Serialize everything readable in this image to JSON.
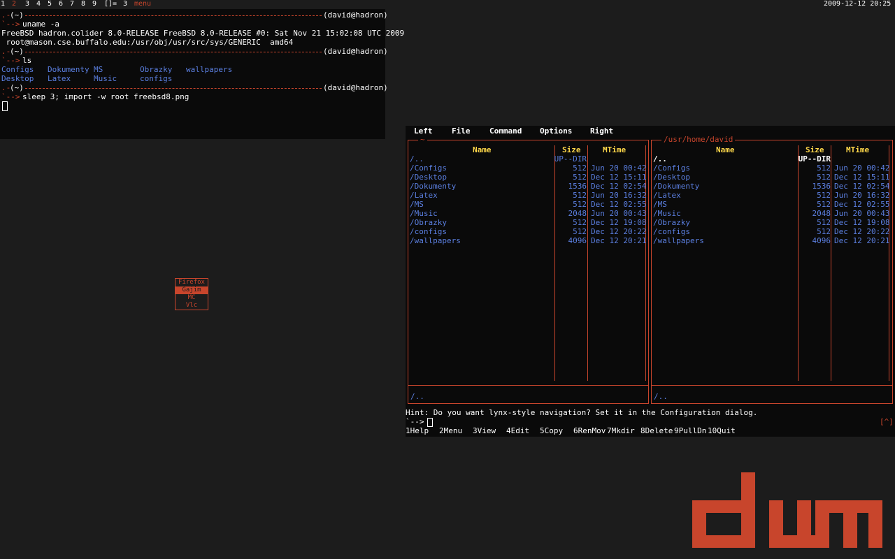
{
  "statusbar": {
    "tags": [
      "1",
      "2",
      "3",
      "4",
      "5",
      "6",
      "7",
      "8",
      "9"
    ],
    "layout": "[]=",
    "client_count": "3",
    "window_title": "menu",
    "clock": "2009-12-12 20:25"
  },
  "terminal": {
    "prompt_host": "(david@hadron)",
    "prompt_dir": "(~)",
    "lines": [
      {
        "cmd": "uname -a"
      },
      {
        "out": "FreeBSD hadron.colider 8.0-RELEASE FreeBSD 8.0-RELEASE #0: Sat Nov 21 15:02:08 UTC 2009"
      },
      {
        "out": " root@mason.cse.buffalo.edu:/usr/obj/usr/src/sys/GENERIC  amd64"
      },
      {
        "cmd": "ls"
      },
      {
        "cmd": "sleep 3; import -w root freebsd8.png"
      }
    ],
    "ls_output": [
      "Configs",
      "Dokumenty",
      "MS",
      "Obrazky",
      "wallpapers",
      "Desktop",
      "Latex",
      "Music",
      "configs"
    ]
  },
  "menu": {
    "items": [
      "Firefox",
      "Gajim",
      "MC",
      "Vlc"
    ],
    "selected": "Gajim"
  },
  "mc": {
    "menubar": [
      "Left",
      "File",
      "Command",
      "Options",
      "Right"
    ],
    "left_panel_title": "~",
    "right_panel_title": "/usr/home/david",
    "columns": {
      "name": "Name",
      "size": "Size",
      "mtime": "MTime"
    },
    "entries": [
      {
        "name": "/..",
        "size": "UP--DIR",
        "mtime": ""
      },
      {
        "name": "/Configs",
        "size": "512",
        "mtime": "Jun 20 00:42"
      },
      {
        "name": "/Desktop",
        "size": "512",
        "mtime": "Dec 12 15:11"
      },
      {
        "name": "/Dokumenty",
        "size": "1536",
        "mtime": "Dec 12 02:54"
      },
      {
        "name": "/Latex",
        "size": "512",
        "mtime": "Jun 20 16:32"
      },
      {
        "name": "/MS",
        "size": "512",
        "mtime": "Dec 12 02:55"
      },
      {
        "name": "/Music",
        "size": "2048",
        "mtime": "Jun 20 00:43"
      },
      {
        "name": "/Obrazky",
        "size": "512",
        "mtime": "Dec 12 19:08"
      },
      {
        "name": "/configs",
        "size": "512",
        "mtime": "Dec 12 20:22"
      },
      {
        "name": "/wallpapers",
        "size": "4096",
        "mtime": "Dec 12 20:21"
      }
    ],
    "mini_status": "/..",
    "hint": "Hint: Do you want lynx-style navigation? Set it in the Configuration dialog.",
    "prompt": "`-->",
    "shell_indicator": "[^]",
    "fkeys": [
      {
        "num": "1",
        "label": "Help"
      },
      {
        "num": "2",
        "label": "Menu"
      },
      {
        "num": "3",
        "label": "View"
      },
      {
        "num": "4",
        "label": "Edit"
      },
      {
        "num": "5",
        "label": "Copy"
      },
      {
        "num": "6",
        "label": "RenMov"
      },
      {
        "num": "7",
        "label": "Mkdir"
      },
      {
        "num": "8",
        "label": "Delete"
      },
      {
        "num": "9",
        "label": "PullDn"
      },
      {
        "num": "10",
        "label": "Quit"
      }
    ]
  },
  "logo": {
    "text": "dwm",
    "color": "#c8452c"
  },
  "colors": {
    "accent": "#c8452c",
    "link": "#5b7fe0",
    "header": "#ffd84a",
    "bg": "#1c1c1c",
    "panel": "#0a0a0a"
  }
}
